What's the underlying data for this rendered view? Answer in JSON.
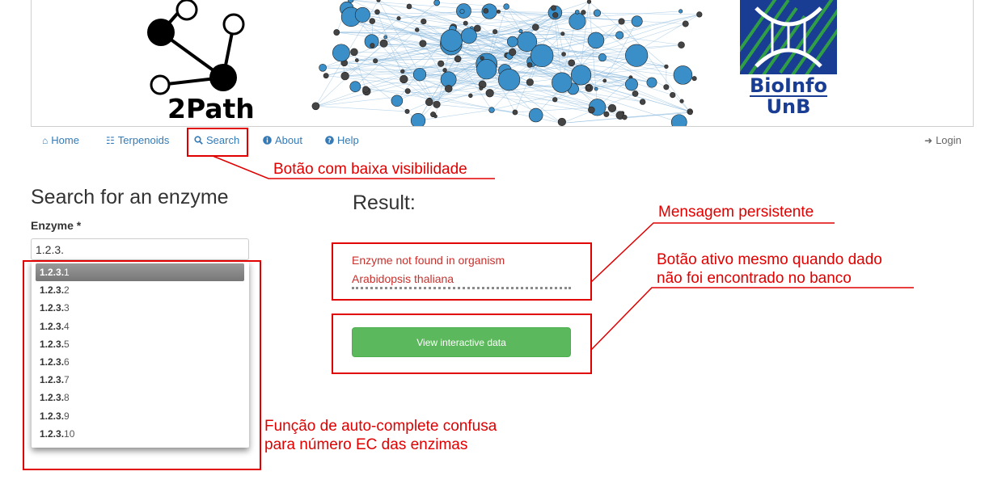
{
  "banner": {
    "logo_text": "2Path",
    "bioinfo_line1": "BioInfo",
    "bioinfo_line2": "UnB"
  },
  "nav": {
    "home": "Home",
    "terpenoids": "Terpenoids",
    "search": "Search",
    "about": "About",
    "help": "Help",
    "login": "Login",
    "icons": [
      "home-icon",
      "sitemap-icon",
      "search-icon",
      "info-icon",
      "question-icon",
      "login-icon"
    ]
  },
  "search": {
    "title": "Search for an enzyme",
    "label": "Enzyme *",
    "input_value": "1.2.3.",
    "autocomplete": [
      {
        "prefix": "1.2.3.",
        "suffix": "1"
      },
      {
        "prefix": "1.2.3.",
        "suffix": "2"
      },
      {
        "prefix": "1.2.3.",
        "suffix": "3"
      },
      {
        "prefix": "1.2.3.",
        "suffix": "4"
      },
      {
        "prefix": "1.2.3.",
        "suffix": "5"
      },
      {
        "prefix": "1.2.3.",
        "suffix": "6"
      },
      {
        "prefix": "1.2.3.",
        "suffix": "7"
      },
      {
        "prefix": "1.2.3.",
        "suffix": "8"
      },
      {
        "prefix": "1.2.3.",
        "suffix": "9"
      },
      {
        "prefix": "1.2.3.",
        "suffix": "10"
      }
    ]
  },
  "result": {
    "title": "Result:",
    "message_line1": "Enzyme not found in organism",
    "message_line2": "Arabidopsis thaliana",
    "button_label": "View interactive data"
  },
  "annotations": {
    "low_visibility": "Botão com baixa visibilidade",
    "persistent_message": "Mensagem persistente",
    "active_button_line1": "Botão ativo mesmo quando dado",
    "active_button_line2": "não foi encontrado no banco",
    "autocomplete_line1": "Função de auto-complete confusa",
    "autocomplete_line2": "para número EC das enzimas"
  },
  "colors": {
    "link": "#337ab7",
    "error": "#c9302c",
    "success": "#5cb85c",
    "annotation": "#e00000",
    "network_node": "#3a8fc9"
  }
}
